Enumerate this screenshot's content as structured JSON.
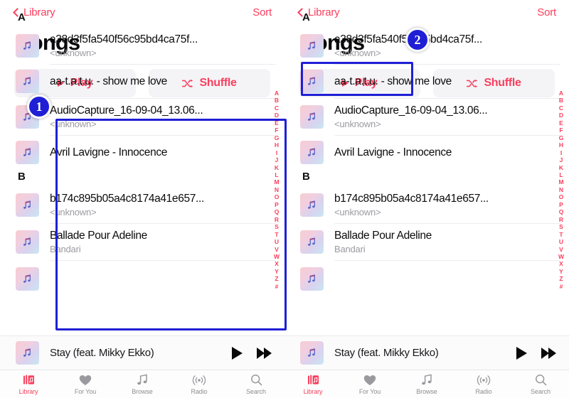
{
  "nav": {
    "back_label": "Library",
    "back_icon": "chevron-left-icon",
    "sort_label": "Sort"
  },
  "page_title": "Songs",
  "actions": {
    "play_label": "Play",
    "play_icon": "play-triangle-icon",
    "shuffle_label": "Shuffle",
    "shuffle_icon": "shuffle-icon"
  },
  "sections": [
    {
      "letter": "A",
      "songs": [
        {
          "title": "a38d3f5fa540f56c95bd4ca75f...",
          "artist": "<unknown>"
        },
        {
          "title": "aa-t.a.t.u. - show me love",
          "artist": ""
        },
        {
          "title": "AudioCapture_16-09-04_13.06...",
          "artist": "<unknown>"
        },
        {
          "title": "Avril Lavigne - Innocence",
          "artist": ""
        }
      ]
    },
    {
      "letter": "B",
      "songs": [
        {
          "title": "b174c895b05a4c8174a41e657...",
          "artist": "<unknown>"
        },
        {
          "title": "Ballade Pour Adeline",
          "artist": "Bandari"
        }
      ]
    }
  ],
  "alphabet_index": [
    "A",
    "B",
    "C",
    "D",
    "E",
    "F",
    "G",
    "H",
    "I",
    "J",
    "K",
    "L",
    "M",
    "N",
    "O",
    "P",
    "Q",
    "R",
    "S",
    "T",
    "U",
    "V",
    "W",
    "X",
    "Y",
    "Z",
    "#"
  ],
  "now_playing": {
    "title": "Stay (feat. Mikky Ekko)",
    "play_icon": "play-icon",
    "next_icon": "fast-forward-icon"
  },
  "tabs": [
    {
      "label": "Library",
      "icon": "library-icon",
      "active": true
    },
    {
      "label": "For You",
      "icon": "heart-icon",
      "active": false
    },
    {
      "label": "Browse",
      "icon": "music-note-icon",
      "active": false
    },
    {
      "label": "Radio",
      "icon": "radio-waves-icon",
      "active": false
    },
    {
      "label": "Search",
      "icon": "search-icon",
      "active": false
    }
  ],
  "annotations": {
    "badge_1": "1",
    "badge_2": "2",
    "highlight_color": "#1f1fd6"
  },
  "colors": {
    "accent": "#fa3f5d",
    "title": "#09090b",
    "subtitle": "#9b9ba1",
    "button_bg": "#f4f4f7",
    "annotation": "#1f1fd6"
  }
}
